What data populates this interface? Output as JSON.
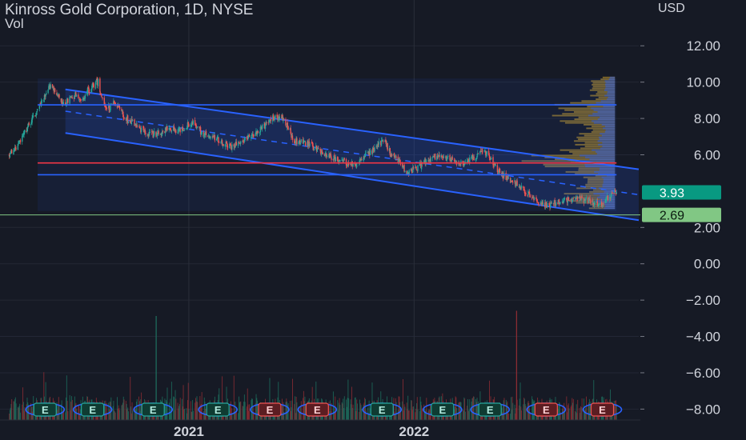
{
  "header": {
    "title": "Kinross Gold Corporation, 1D, NYSE",
    "subtitle": "Vol"
  },
  "chart_data": {
    "type": "candlestick",
    "axis_unit": "USD",
    "ylim": [
      -8.6,
      13.2
    ],
    "y_ticks": [
      {
        "value": 12,
        "label": "12.00"
      },
      {
        "value": 10,
        "label": "10.00"
      },
      {
        "value": 8,
        "label": "8.00"
      },
      {
        "value": 6,
        "label": "6.00"
      },
      {
        "value": 2,
        "label": "2.00"
      },
      {
        "value": 0,
        "label": "0.00"
      },
      {
        "value": -2,
        "label": "−2.00"
      },
      {
        "value": -4,
        "label": "−4.00"
      },
      {
        "value": -6,
        "label": "−6.00"
      },
      {
        "value": -8,
        "label": "−8.00"
      }
    ],
    "x_range": [
      "2020-03-01",
      "2022-12-31"
    ],
    "x_ticks": [
      {
        "date": "2021-01-01",
        "label": "2021"
      },
      {
        "date": "2022-01-01",
        "label": "2022"
      }
    ],
    "price_labels": [
      {
        "value": 3.93,
        "label": "3.93",
        "color": "#089981"
      },
      {
        "value": 2.69,
        "label": "2.69",
        "color": "#81c784"
      }
    ],
    "price_path": [
      [
        "2020-03-16",
        6.0
      ],
      [
        "2020-03-25",
        6.3
      ],
      [
        "2020-04-05",
        6.9
      ],
      [
        "2020-04-15",
        7.5
      ],
      [
        "2020-04-25",
        8.1
      ],
      [
        "2020-05-05",
        8.7
      ],
      [
        "2020-05-15",
        9.3
      ],
      [
        "2020-05-22",
        9.9
      ],
      [
        "2020-06-01",
        9.4
      ],
      [
        "2020-06-10",
        8.8
      ],
      [
        "2020-06-20",
        9.0
      ],
      [
        "2020-07-01",
        9.3
      ],
      [
        "2020-07-10",
        8.9
      ],
      [
        "2020-07-20",
        9.5
      ],
      [
        "2020-08-01",
        9.9
      ],
      [
        "2020-08-07",
        10.0
      ],
      [
        "2020-08-15",
        8.9
      ],
      [
        "2020-08-25",
        8.5
      ],
      [
        "2020-09-01",
        9.0
      ],
      [
        "2020-09-10",
        8.6
      ],
      [
        "2020-09-20",
        8.0
      ],
      [
        "2020-10-01",
        7.8
      ],
      [
        "2020-10-15",
        7.4
      ],
      [
        "2020-11-01",
        7.1
      ],
      [
        "2020-11-15",
        7.2
      ],
      [
        "2020-12-01",
        7.5
      ],
      [
        "2020-12-15",
        7.3
      ],
      [
        "2021-01-05",
        7.8
      ],
      [
        "2021-01-20",
        7.3
      ],
      [
        "2021-02-01",
        7.0
      ],
      [
        "2021-02-15",
        6.9
      ],
      [
        "2021-03-01",
        6.6
      ],
      [
        "2021-03-10",
        6.4
      ],
      [
        "2021-03-25",
        6.7
      ],
      [
        "2021-04-10",
        7.0
      ],
      [
        "2021-04-25",
        7.3
      ],
      [
        "2021-05-10",
        7.8
      ],
      [
        "2021-05-20",
        8.1
      ],
      [
        "2021-06-01",
        8.0
      ],
      [
        "2021-06-10",
        7.6
      ],
      [
        "2021-06-20",
        6.8
      ],
      [
        "2021-07-01",
        6.7
      ],
      [
        "2021-07-20",
        6.5
      ],
      [
        "2021-08-10",
        6.0
      ],
      [
        "2021-08-25",
        5.8
      ],
      [
        "2021-09-10",
        5.6
      ],
      [
        "2021-09-25",
        5.4
      ],
      [
        "2021-10-10",
        5.9
      ],
      [
        "2021-10-25",
        6.2
      ],
      [
        "2021-11-05",
        6.6
      ],
      [
        "2021-11-15",
        6.7
      ],
      [
        "2021-11-25",
        6.0
      ],
      [
        "2021-12-10",
        5.6
      ],
      [
        "2021-12-20",
        5.0
      ],
      [
        "2022-01-01",
        5.2
      ],
      [
        "2022-01-20",
        5.6
      ],
      [
        "2022-02-05",
        5.9
      ],
      [
        "2022-02-20",
        5.8
      ],
      [
        "2022-03-05",
        5.7
      ],
      [
        "2022-03-20",
        5.5
      ],
      [
        "2022-04-05",
        5.8
      ],
      [
        "2022-04-15",
        6.0
      ],
      [
        "2022-04-25",
        6.2
      ],
      [
        "2022-05-05",
        5.8
      ],
      [
        "2022-05-15",
        5.2
      ],
      [
        "2022-05-25",
        4.9
      ],
      [
        "2022-06-05",
        4.6
      ],
      [
        "2022-06-15",
        4.4
      ],
      [
        "2022-06-25",
        4.1
      ],
      [
        "2022-07-05",
        3.9
      ],
      [
        "2022-07-15",
        3.6
      ],
      [
        "2022-07-25",
        3.3
      ],
      [
        "2022-08-05",
        3.2
      ],
      [
        "2022-08-20",
        3.4
      ],
      [
        "2022-09-05",
        3.5
      ],
      [
        "2022-09-20",
        3.6
      ],
      [
        "2022-10-05",
        3.5
      ],
      [
        "2022-10-20",
        3.4
      ],
      [
        "2022-11-01",
        3.3
      ],
      [
        "2022-11-10",
        3.6
      ],
      [
        "2022-11-20",
        3.9
      ],
      [
        "2022-11-25",
        3.93
      ]
    ],
    "channel": {
      "start": "2020-06-15",
      "end": "2022-12-31",
      "upper": [
        9.6,
        5.2
      ],
      "middle": [
        8.4,
        3.8
      ],
      "lower": [
        7.2,
        2.4
      ],
      "color": "#2962ff"
    },
    "range_box": {
      "start": "2020-05-01",
      "end": "2022-11-25",
      "top": 10.2,
      "bottom": 2.9
    },
    "hlines": [
      {
        "value": 8.75,
        "color": "#2962ff"
      },
      {
        "value": 4.9,
        "color": "#2962ff"
      },
      {
        "value": 5.55,
        "color": "#f23645"
      },
      {
        "value": 2.69,
        "color": "#81c784"
      }
    ],
    "earnings_markers": {
      "label": "E",
      "events": [
        {
          "date": "2020-05-13",
          "type": "beat"
        },
        {
          "date": "2020-07-29",
          "type": "beat"
        },
        {
          "date": "2020-11-04",
          "type": "beat"
        },
        {
          "date": "2021-02-17",
          "type": "beat"
        },
        {
          "date": "2021-05-12",
          "type": "miss"
        },
        {
          "date": "2021-07-28",
          "type": "miss"
        },
        {
          "date": "2021-11-10",
          "type": "beat"
        },
        {
          "date": "2022-02-16",
          "type": "beat"
        },
        {
          "date": "2022-05-04",
          "type": "beat"
        },
        {
          "date": "2022-08-03",
          "type": "miss"
        },
        {
          "date": "2022-11-02",
          "type": "miss"
        }
      ]
    },
    "volume_spikes": [
      {
        "date": "2020-11-09",
        "height": 1.0
      },
      {
        "date": "2022-06-16",
        "height": 1.05
      }
    ]
  }
}
